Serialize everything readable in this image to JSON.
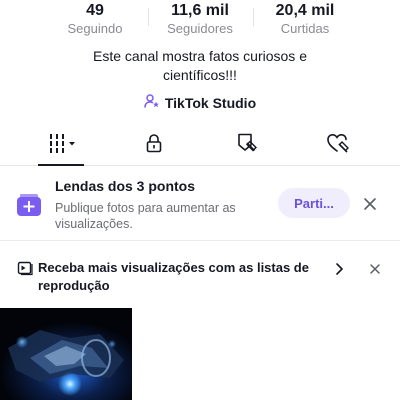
{
  "stats": [
    {
      "value": "49",
      "label": "Seguindo"
    },
    {
      "value": "11,6 mil",
      "label": "Seguidores"
    },
    {
      "value": "20,4 mil",
      "label": "Curtidas"
    }
  ],
  "bio": "Este canal mostra fatos curiosos e científicos!!!",
  "studio": {
    "label": "TikTok Studio",
    "icon": "person-star-icon"
  },
  "tabs": [
    {
      "icon": "grid-icon",
      "active": true
    },
    {
      "icon": "lock-icon",
      "active": false
    },
    {
      "icon": "bookmark-tag-icon",
      "active": false
    },
    {
      "icon": "heart-hidden-icon",
      "active": false
    }
  ],
  "promo": {
    "title": "Lendas dos 3 pontos",
    "subtitle": "Publique fotos para aumentar as visualizações.",
    "button": "Parti...",
    "icon": "photo-stack-plus-icon"
  },
  "playlist": {
    "text": "Receba mais visualizações com as listas de reprodução",
    "icon": "playlist-icon"
  },
  "colors": {
    "accent": "#7b5cf0",
    "button_bg": "#f0eefc",
    "button_text": "#6b52d9",
    "secondary_text": "#8a8b91"
  }
}
